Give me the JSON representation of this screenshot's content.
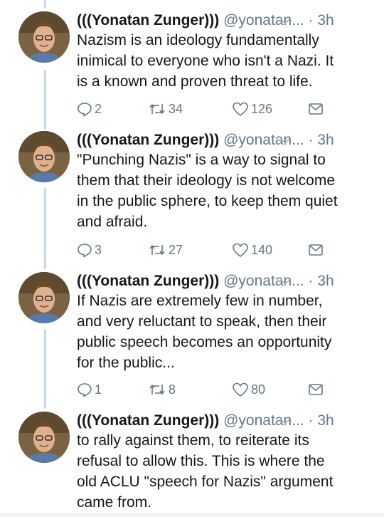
{
  "colors": {
    "text": "#14171a",
    "meta": "#657786",
    "thread": "#ccd6dd"
  },
  "tweets": [
    {
      "name": "(((Yonatan Zunger)))",
      "handle": "@yonatan...",
      "dot": "·",
      "time": "3h",
      "text": "Nazism is an ideology fundamentally\ninimical to everyone who isn't a Nazi. It\nis a known and proven threat to life.",
      "replies": "2",
      "retweets": "34",
      "likes": "126"
    },
    {
      "name": "(((Yonatan Zunger)))",
      "handle": "@yonatan...",
      "dot": "·",
      "time": "3h",
      "text": "\"Punching Nazis\" is a way to signal to\nthem that their ideology is not welcome\nin the public sphere, to keep them quiet\nand afraid.",
      "replies": "3",
      "retweets": "27",
      "likes": "140"
    },
    {
      "name": "(((Yonatan Zunger)))",
      "handle": "@yonatan...",
      "dot": "·",
      "time": "3h",
      "text": "If Nazis are extremely few in number,\nand very reluctant to speak, then their\npublic speech becomes an opportunity\nfor the public...",
      "replies": "1",
      "retweets": "8",
      "likes": "80"
    },
    {
      "name": "(((Yonatan Zunger)))",
      "handle": "@yonatan...",
      "dot": "·",
      "time": "3h",
      "text": "to rally against them, to reiterate its\nrefusal to allow this. This is where the\nold ACLU \"speech for Nazis\" argument\ncame from."
    }
  ]
}
